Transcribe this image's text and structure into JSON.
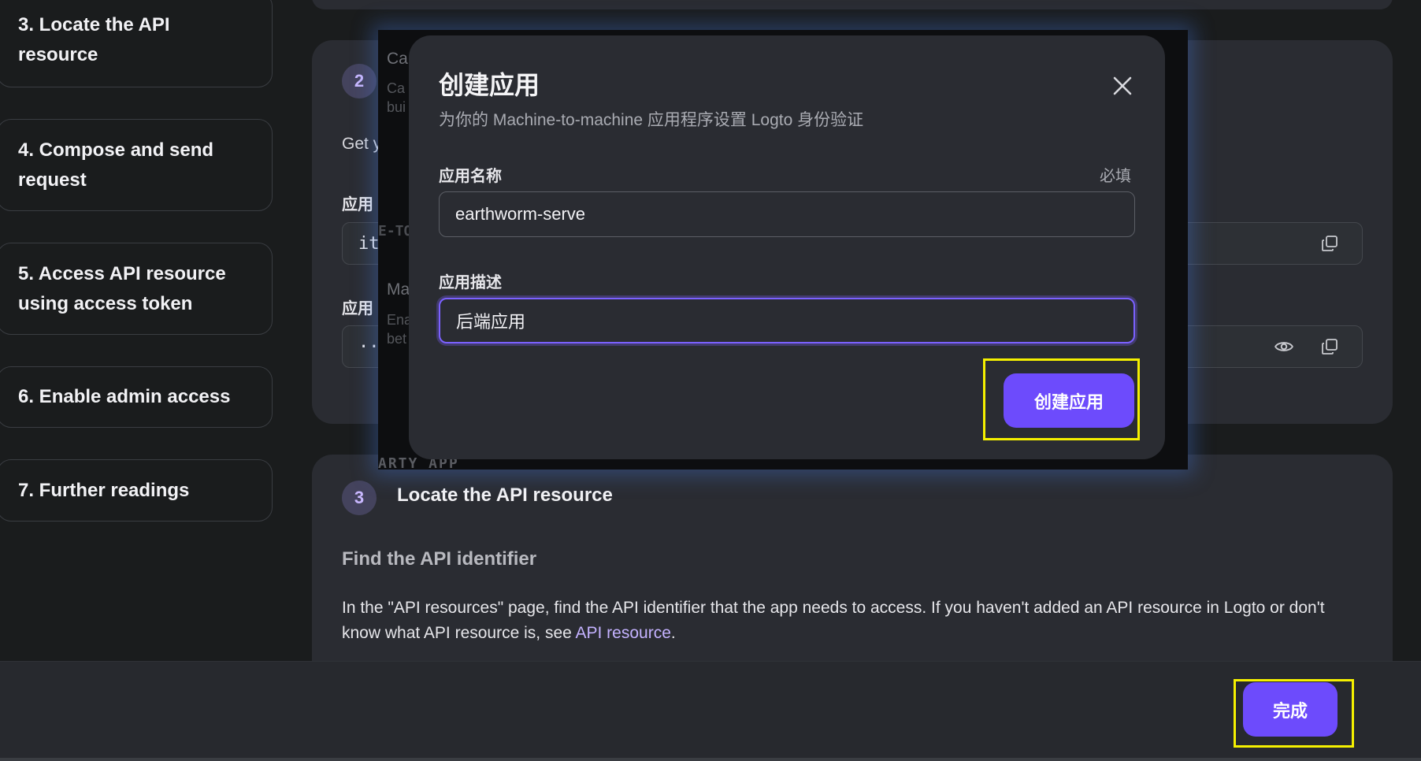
{
  "sidebar": {
    "steps": [
      {
        "label": "3. Locate the API resource"
      },
      {
        "label": "4. Compose and send request"
      },
      {
        "label": "5. Access API resource using access token"
      },
      {
        "label": "6. Enable admin access"
      },
      {
        "label": "7. Further readings"
      }
    ]
  },
  "card2": {
    "step_number": "2",
    "title_fragment": "Ca",
    "desc_fragment_1": "Ca",
    "desc_fragment_2": "bui",
    "text_fragment": "Get y",
    "field1_label": "应用",
    "field1_value": "it",
    "field1_overlay": "E-TO",
    "field2_label": "应用",
    "field2_value": "··",
    "overlay_title2": "Ma",
    "overlay_desc2a": "Ena",
    "overlay_desc2b": "bet"
  },
  "card3": {
    "step_number": "3",
    "overlay_fragment": "ARTY APP",
    "title": "Locate the API resource",
    "subtitle": "Find the API identifier",
    "paragraph_before_link": "In the \"API resources\" page, find the API identifier that the app needs to access. If you haven't added an API resource in Logto or don't know what API resource is, see ",
    "link_text": "API resource",
    "paragraph_after_link": "."
  },
  "modal": {
    "title": "创建应用",
    "subtitle": "为你的 Machine-to-machine 应用程序设置 Logto 身份验证",
    "name_label": "应用名称",
    "required_label": "必填",
    "name_value": "earthworm-serve",
    "desc_label": "应用描述",
    "desc_value": "后端应用",
    "create_button": "创建应用"
  },
  "footer": {
    "done_button": "完成"
  },
  "colors": {
    "accent": "#6d4bfc",
    "highlight": "#f5f000",
    "link": "#c4b2ff"
  }
}
